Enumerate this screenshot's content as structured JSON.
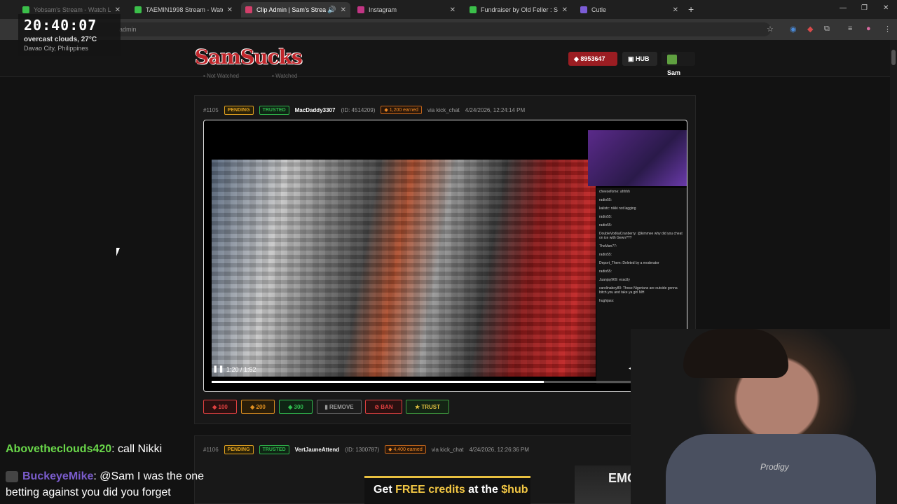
{
  "browser": {
    "tabs": [
      {
        "label": "Yobsam's Stream - Watch Li",
        "color": "#3bbf4a",
        "active": false
      },
      {
        "label": "TAEMIN1998 Stream - Watch Li",
        "color": "#3bbf4a",
        "active": false
      },
      {
        "label": "Clip Admin | Sam's Stream",
        "color": "#d23f6a",
        "active": true
      },
      {
        "label": "Instagram",
        "color": "#c13584",
        "active": false
      },
      {
        "label": "Fundraiser by Old Feller : Suppo",
        "color": "#3bbf4a",
        "active": false
      },
      {
        "label": "Cutle",
        "color": "#7b5cd6",
        "active": false
      }
    ],
    "url": "admin"
  },
  "clock": {
    "time": "20:40:07",
    "weather": "overcast clouds, 27°C",
    "location": "Davao City, Philippines"
  },
  "site": {
    "logo": "SamSucks",
    "credits": "8953647",
    "hub_label": "HUB",
    "user": "Sam",
    "filters": [
      "Not Watched",
      "Watched"
    ]
  },
  "clips": [
    {
      "number": "#1105",
      "status": "PENDING",
      "trust": "TRUSTED",
      "username": "MacDaddy3307",
      "id": "(ID: 4514209)",
      "earned": "1,200 earned",
      "via": "via kick_chat",
      "date": "4/24/2026, 12:24:14 PM",
      "player": {
        "time": "1:20 / 1:52",
        "progress": 0.71
      }
    },
    {
      "number": "#1106",
      "status": "PENDING",
      "trust": "TRUSTED",
      "username": "VertJauneAttend",
      "id": "(ID: 1300787)",
      "earned": "4,400 earned",
      "via": "via kick_chat",
      "date": "4/24/2026, 12:26:36 PM"
    }
  ],
  "actions": {
    "a100": "100",
    "a200": "200",
    "a300": "300",
    "remove": "REMOVE",
    "ban": "BAN",
    "trust": "TRUST"
  },
  "stream_chat": [
    {
      "name": "Abovetheclouds420",
      "message": ": call Nikki"
    },
    {
      "name": "BuckeyeMike",
      "message": ": @Sam I was the one betting against you did you forget"
    }
  ],
  "banner": {
    "pre": "Get ",
    "highlight1": "FREE credits",
    "mid": " at the ",
    "highlight2": "$hub"
  },
  "emg_text": "EMG TO",
  "webcam_shirt": "Prodigy",
  "video_chat_lines": [
    "cheesefome: ahhhh",
    "radio55:",
    "kalistc: nikki not lagging",
    "radio55:",
    "radio55:",
    "DoubleVodkaCranberry: @kimmee why did you cheat on ice with Gewn???",
    "TheMan77:",
    "radio55:",
    "Deport_Them: Deleted by a moderator",
    "radio55:",
    "Juanjay969: exactly",
    "carolinaboy80: Those Nigerians are outside gonna bitch you and take ya girl MH",
    "hughjass:"
  ]
}
